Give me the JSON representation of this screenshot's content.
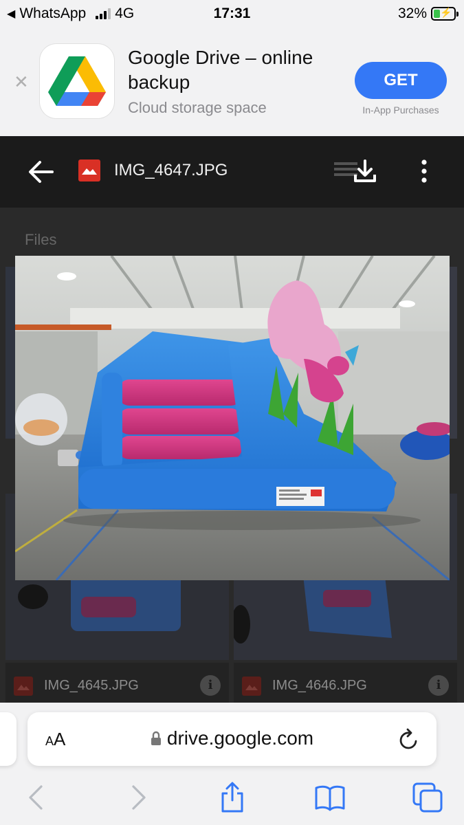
{
  "status_bar": {
    "back_app": "WhatsApp",
    "network": "4G",
    "time": "17:31",
    "battery_text": "32%",
    "battery_level": 0.32
  },
  "app_banner": {
    "title": "Google Drive – online backup",
    "subtitle": "Cloud storage space",
    "get_label": "GET",
    "in_app_purchases": "In-App Purchases"
  },
  "viewer": {
    "file_name": "IMG_4647.JPG",
    "section_label": "Files",
    "background_files": [
      {
        "name": "IMG_4645.JPG"
      },
      {
        "name": "IMG_4646.JPG"
      }
    ]
  },
  "safari": {
    "text_size_label": "AA",
    "url": "drive.google.com"
  },
  "colors": {
    "accent": "#3478f6",
    "file_icon": "#d93025"
  }
}
